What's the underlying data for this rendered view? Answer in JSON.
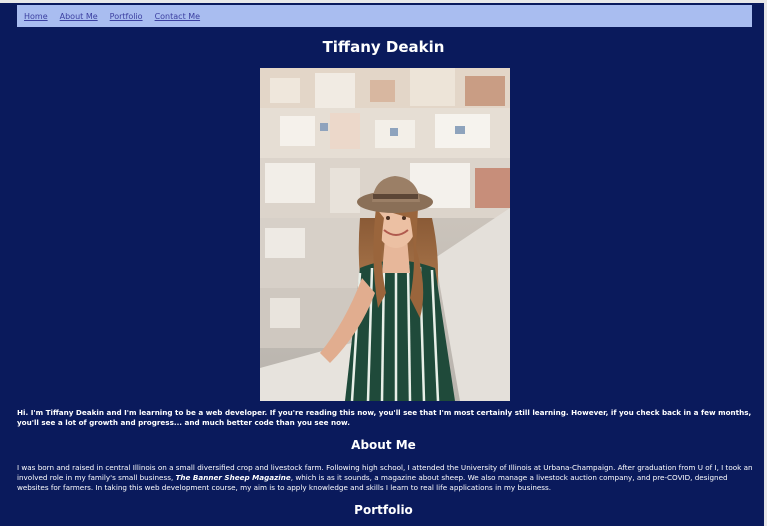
{
  "nav": {
    "items": [
      {
        "label": "Home"
      },
      {
        "label": "About Me"
      },
      {
        "label": "Portfolio"
      },
      {
        "label": "Contact Me"
      }
    ]
  },
  "page_title": "Tiffany Deakin",
  "intro": "Hi. I'm Tiffany Deakin and I'm learning to be a web developer. If you're reading this now, you'll see that I'm most certainly still learning. However, if you check back in a few months, you'll see a lot of growth and progress... and much better code than you see now.",
  "about": {
    "heading": "About Me",
    "text_part1": "I was born and raised in central Illinois on a small diversified crop and livestock farm. Following high school, I attended the University of Illinois at Urbana-Champaign. After graduation from U of I, I took an involved role in my family's small business,",
    "magazine": "The Banner Sheep Magazine",
    "text_part2": ", which is as it sounds, a magazine about sheep. We also manage a livestock auction company, and pre-COVID, designed websites for farmers. In taking this web development course, my aim is to apply knowledge and skills I learn to real life applications in my business."
  },
  "portfolio": {
    "heading": "Portfolio"
  },
  "colors": {
    "background": "#0a1a5c",
    "nav_bg": "#a9bdf0",
    "nav_link": "#3b3fa0",
    "text": "#ffffff"
  }
}
